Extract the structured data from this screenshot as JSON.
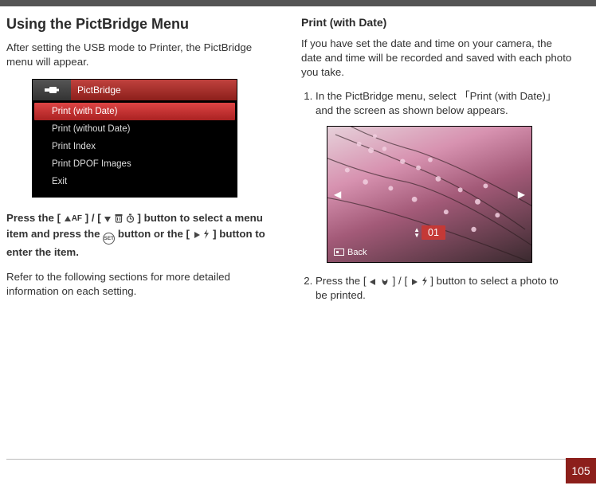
{
  "page_number": "105",
  "heading": "Using the PictBridge Menu",
  "left": {
    "intro": "After setting the USB mode to Printer, the PictBridge menu will appear.",
    "menu_title": "PictBridge",
    "menu_items": [
      "Print (with Date)",
      "Print (without Date)",
      "Print Index",
      "Print DPOF Images",
      "Exit"
    ],
    "instr_a": "Press the [",
    "af_label": "AF",
    "instr_b": "] / [",
    "instr_c": "] button to select a menu item and press the ",
    "set_label": "SET",
    "instr_d": " button or the [",
    "instr_e": "] button to enter the item.",
    "refer": "Refer to the following sections for more detailed information on each setting."
  },
  "right": {
    "subtitle": "Print (with Date)",
    "intro": "If you have set the date and time on your camera, the date and time will be recorded and saved with each photo you take.",
    "step1": "In the PictBridge menu, select 「Print (with Date)」 and the screen as shown below appears.",
    "counter": "01",
    "back_label": "Back",
    "step2a": "Press the [",
    "step2b": "] / [",
    "step2c": "] button to select a photo to be printed."
  }
}
